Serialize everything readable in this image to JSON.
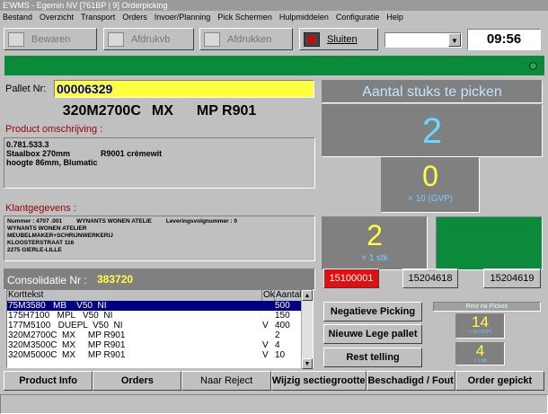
{
  "window": {
    "title": "E'WMS - Egemin NV [761BP | 9] Orderpicking"
  },
  "menu": [
    "Bestand",
    "Overzicht",
    "Transport",
    "Orders",
    "Invoer/Planning",
    "Pick Schermen",
    "Hulpmiddelen",
    "Configuratie",
    "Help"
  ],
  "toolbar": {
    "save": "Bewaren",
    "print_preview": "Afdrukvb",
    "print": "Afdrukken",
    "close": "Sluiten",
    "clock": "09:56"
  },
  "pallet": {
    "label": "Pallet Nr:",
    "value": "00006329"
  },
  "article": {
    "code": "320M2700C",
    "unit": "MX",
    "variant": "MP R901"
  },
  "description": {
    "title": "Product omschrijving :",
    "line1": "0.781.533.3",
    "line2a": "Staalbox 270mm",
    "line2b": "R9001 crèmewit",
    "line3": "hoogte 86mm, Blumatic"
  },
  "customer": {
    "title": "Klantgegevens :",
    "number": "Nummer : 4707 .001",
    "name_inline": "WYNANTS WONEN ATELIE",
    "delivery": "Leveringsvolgnummer : 0",
    "line2": "WYNANTS WONEN ATELIER",
    "line3": "MEUBELMAKER+SCHRIJNWERKERIJ",
    "line4": "KLOOSTERSTRAAT 116",
    "line5": "2275 GIERLE-LILLE"
  },
  "consolidation": {
    "label": "Consolidatie Nr :",
    "value": "383720"
  },
  "table": {
    "headers": [
      "Korttekst",
      "Ok",
      "Aantal"
    ],
    "rows": [
      {
        "text": "75M3580   MB    V50  NI",
        "ok": "",
        "qty": "500"
      },
      {
        "text": "175H7100   MPL   V50  NI",
        "ok": "",
        "qty": "150"
      },
      {
        "text": "177M5100   DUEPL  V50  NI",
        "ok": "V",
        "qty": "400"
      },
      {
        "text": "320M2700C  MX     MP R901",
        "ok": "",
        "qty": "2"
      },
      {
        "text": "320M3500C  MX     MP R901",
        "ok": "V",
        "qty": "4"
      },
      {
        "text": "320M5000C  MX     MP R901",
        "ok": "V",
        "qty": "10"
      }
    ]
  },
  "pick": {
    "title": "Aantal stuks te picken",
    "total": "2",
    "gvp_qty": "0",
    "gvp_label": "× 10 (GVP)",
    "stk_qty": "2",
    "stk_label": "× 1 stk"
  },
  "locations": [
    "15100001",
    "15204618",
    "15204619"
  ],
  "actions": {
    "negative": "Negatieve Picking",
    "new_pallet": "Nieuwe Lege pallet",
    "rest_count": "Rest telling"
  },
  "rest": {
    "label": "Rest na Picken",
    "gvp_qty": "14",
    "gvp_label": "× 10 (GVP)",
    "stk_qty": "4",
    "stk_label": "× 1 stk"
  },
  "bottom": [
    "Product Info",
    "Orders",
    "Naar Reject",
    "Wijzig sectiegrootte",
    "Beschadigd / Fout",
    "Order gepickt"
  ],
  "colors": {
    "green": "#0a8a3a",
    "yellow": "#ffff40",
    "red": "#e01010",
    "selection": "#000080"
  }
}
